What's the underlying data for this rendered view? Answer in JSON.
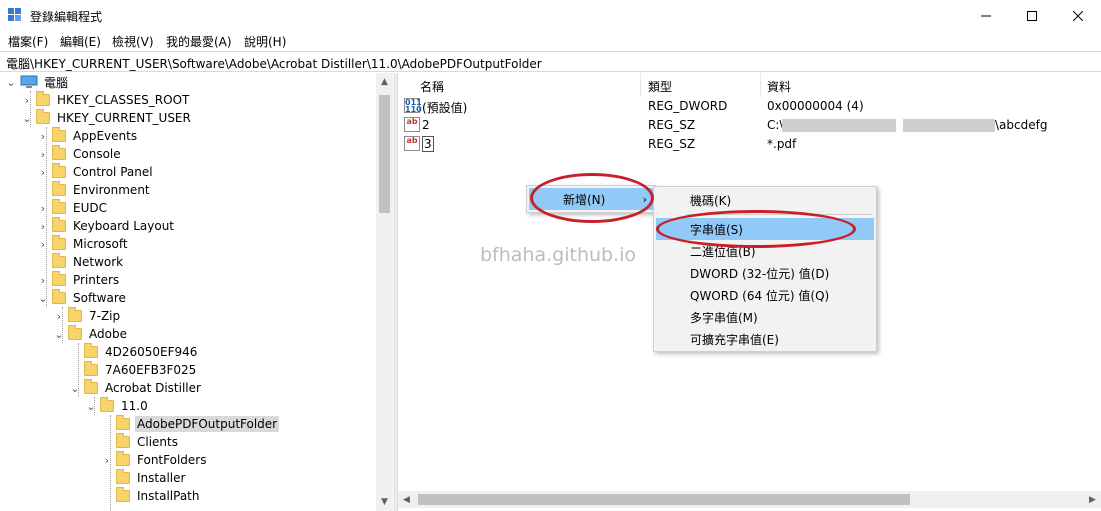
{
  "window": {
    "title": "登錄編輯程式"
  },
  "menubar": [
    {
      "label": "檔案(F)"
    },
    {
      "label": "編輯(E)"
    },
    {
      "label": "檢視(V)"
    },
    {
      "label": "我的最愛(A)"
    },
    {
      "label": "說明(H)"
    }
  ],
  "address": {
    "path": "電腦\\HKEY_CURRENT_USER\\Software\\Adobe\\Acrobat Distiller\\11.0\\AdobePDFOutputFolder"
  },
  "tree": [
    {
      "label": "電腦",
      "toggle": "⌄"
    },
    {
      "label": "HKEY_CLASSES_ROOT",
      "toggle": "›"
    },
    {
      "label": "HKEY_CURRENT_USER",
      "toggle": "⌄"
    },
    {
      "label": "AppEvents",
      "toggle": "›"
    },
    {
      "label": "Console",
      "toggle": "›"
    },
    {
      "label": "Control Panel",
      "toggle": "›"
    },
    {
      "label": "Environment",
      "toggle": ""
    },
    {
      "label": "EUDC",
      "toggle": "›"
    },
    {
      "label": "Keyboard Layout",
      "toggle": "›"
    },
    {
      "label": "Microsoft",
      "toggle": "›"
    },
    {
      "label": "Network",
      "toggle": ""
    },
    {
      "label": "Printers",
      "toggle": "›"
    },
    {
      "label": "Software",
      "toggle": "⌄"
    },
    {
      "label": "7-Zip",
      "toggle": "›"
    },
    {
      "label": "Adobe",
      "toggle": "⌄"
    },
    {
      "label": "4D26050EF946",
      "toggle": ""
    },
    {
      "label": "7A60EFB3F025",
      "toggle": ""
    },
    {
      "label": "Acrobat Distiller",
      "toggle": "⌄"
    },
    {
      "label": "11.0",
      "toggle": "⌄"
    },
    {
      "label": "AdobePDFOutputFolder",
      "toggle": "",
      "selected": true
    },
    {
      "label": "Clients",
      "toggle": ""
    },
    {
      "label": "FontFolders",
      "toggle": "›"
    },
    {
      "label": "Installer",
      "toggle": ""
    },
    {
      "label": "InstallPath",
      "toggle": ""
    }
  ],
  "list": {
    "columns": {
      "name": "名稱",
      "type": "類型",
      "data": "資料"
    },
    "rows": [
      {
        "name": "(預設值)",
        "type": "REG_DWORD",
        "data": "0x00000004 (4)",
        "icon": "binary-value-icon"
      },
      {
        "name": "2",
        "type": "REG_SZ",
        "data_prefix": "C:\\",
        "data_suffix": "\\abcdefg",
        "icon": "string-value-icon"
      },
      {
        "name": "3",
        "type": "REG_SZ",
        "data": "*.pdf",
        "icon": "string-value-icon"
      }
    ]
  },
  "watermark": "bfhaha.github.io",
  "context_menu": {
    "new_item": "新增(N)",
    "submenu": [
      {
        "label": "機碼(K)"
      },
      {
        "label": "字串值(S)",
        "highlighted": true
      },
      {
        "label": "二進位值(B)"
      },
      {
        "label": "DWORD (32-位元) 值(D)"
      },
      {
        "label": "QWORD (64 位元) 值(Q)"
      },
      {
        "label": "多字串值(M)"
      },
      {
        "label": "可擴充字串值(E)"
      }
    ]
  },
  "colors": {
    "highlight": "#91c9f7",
    "annotation": "#c8202a"
  }
}
